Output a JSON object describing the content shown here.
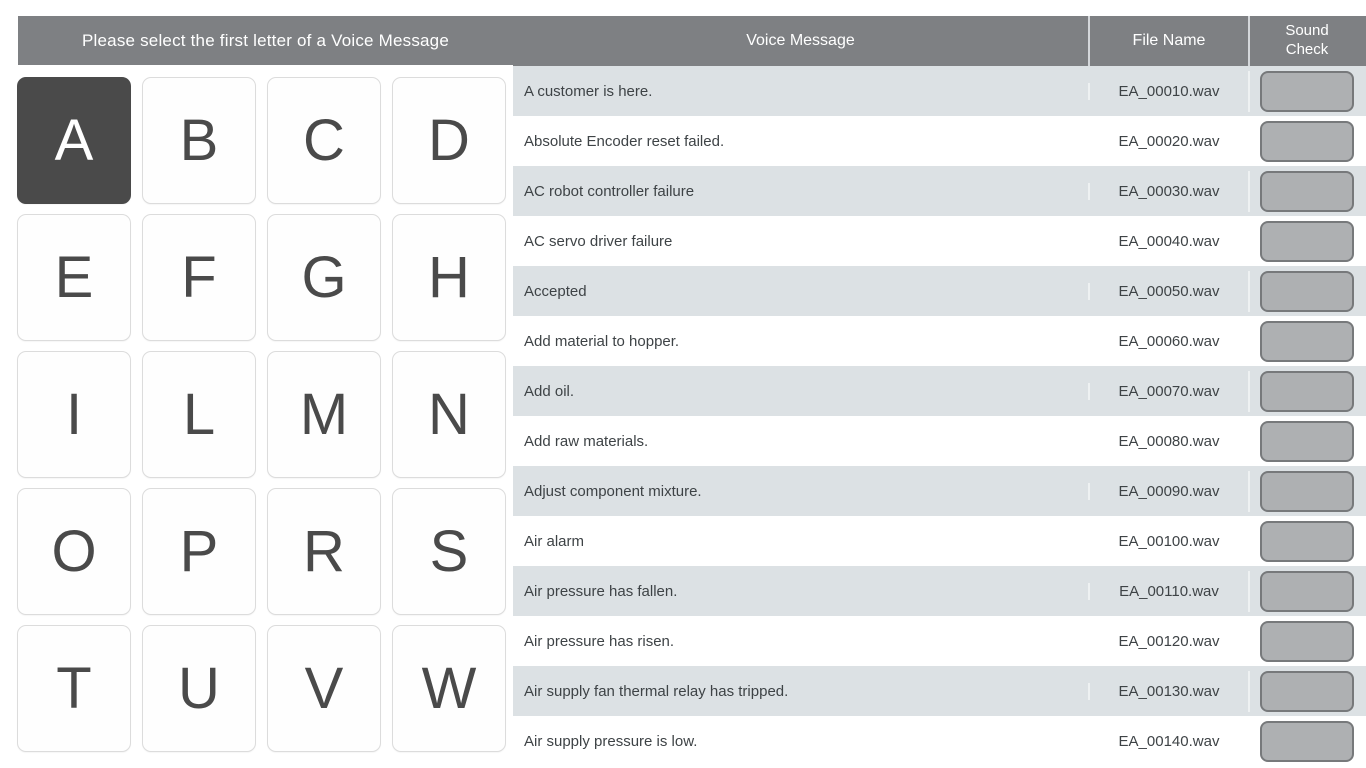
{
  "left_panel": {
    "prompt_header": "Please select the first letter of a Voice Message",
    "selected_letter": "A",
    "letters": [
      "A",
      "B",
      "C",
      "D",
      "E",
      "F",
      "G",
      "H",
      "I",
      "L",
      "M",
      "N",
      "O",
      "P",
      "R",
      "S",
      "T",
      "U",
      "V",
      "W"
    ]
  },
  "table": {
    "columns": {
      "voice_message": "Voice Message",
      "file_name": "File Name",
      "sound_check_line1": "Sound",
      "sound_check_line2": "Check"
    },
    "rows": [
      {
        "message": "A customer is here.",
        "file": "EA_00010.wav"
      },
      {
        "message": "Absolute Encoder reset failed.",
        "file": "EA_00020.wav"
      },
      {
        "message": "AC robot controller failure",
        "file": "EA_00030.wav"
      },
      {
        "message": "AC servo driver failure",
        "file": "EA_00040.wav"
      },
      {
        "message": "Accepted",
        "file": "EA_00050.wav"
      },
      {
        "message": "Add material to hopper.",
        "file": "EA_00060.wav"
      },
      {
        "message": "Add oil.",
        "file": "EA_00070.wav"
      },
      {
        "message": "Add raw materials.",
        "file": "EA_00080.wav"
      },
      {
        "message": "Adjust component mixture.",
        "file": "EA_00090.wav"
      },
      {
        "message": "Air alarm",
        "file": "EA_00100.wav"
      },
      {
        "message": "Air pressure has fallen.",
        "file": "EA_00110.wav"
      },
      {
        "message": "Air pressure has risen.",
        "file": "EA_00120.wav"
      },
      {
        "message": "Air supply fan thermal relay has tripped.",
        "file": "EA_00130.wav"
      },
      {
        "message": "Air supply pressure is low.",
        "file": "EA_00140.wav"
      }
    ],
    "sound_check_icon": "sound-check-button"
  },
  "scroll": {
    "down_icon": "chevron-down-icon"
  },
  "colors": {
    "header_bar": "#7e8083",
    "selected_key": "#4a4a4a",
    "row_alt": "#dce1e4",
    "sound_button": "#aeb0b2",
    "sound_button_border": "#77797b",
    "scroll_button": "#a8abad",
    "text": "#3e4346"
  }
}
